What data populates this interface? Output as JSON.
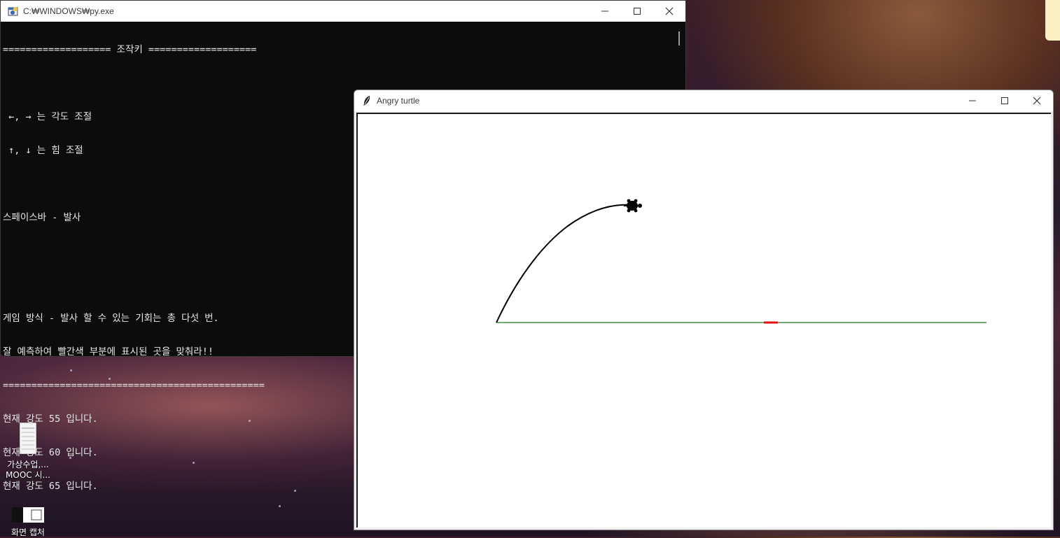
{
  "console": {
    "title": "C:₩WINDOWS₩py.exe",
    "lines": [
      "=================== 조작키 ===================",
      "",
      " ←, → 는 각도 조절",
      " ↑, ↓ 는 힘 조절",
      "",
      "스페이스바 - 발사",
      "",
      "",
      "게임 방식 - 발사 할 수 있는 기회는 총 다섯 번.",
      "잘 예측하여 빨간색 부분에 표시된 곳을 맞춰라!!",
      "==============================================",
      "현재 강도 55 입니다.",
      "현재 강도 60 입니다.",
      "현재 강도 65 입니다."
    ]
  },
  "turtle_window": {
    "title": "Angry turtle",
    "colors": {
      "ground": "#1a7a1a",
      "target": "#e01010",
      "trajectory": "#000000",
      "turtle": "#000000"
    }
  },
  "desktop": {
    "icons": [
      {
        "line1": "가상수업,...",
        "line2": "MOOC 시..."
      },
      {
        "line1": "화면 캡처",
        "line2": ""
      }
    ]
  },
  "window_controls": {
    "minimize": "minimize-icon",
    "maximize": "maximize-icon",
    "close": "close-icon"
  }
}
